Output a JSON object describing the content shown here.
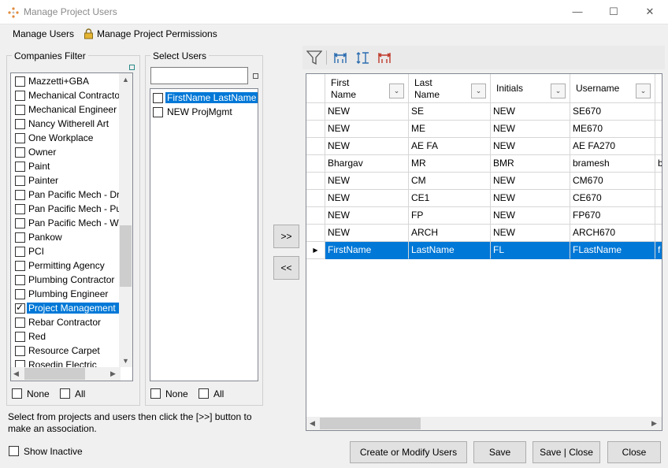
{
  "window": {
    "title": "Manage Project Users"
  },
  "menu": {
    "manage_users": "Manage Users",
    "manage_permissions": "Manage Project Permissions"
  },
  "companies": {
    "title": "Companies Filter",
    "items": [
      {
        "label": "Mazzetti+GBA",
        "checked": false,
        "selected": false
      },
      {
        "label": "Mechanical Contracto",
        "checked": false,
        "selected": false
      },
      {
        "label": "Mechanical Engineer",
        "checked": false,
        "selected": false
      },
      {
        "label": "Nancy Witherell Art",
        "checked": false,
        "selected": false
      },
      {
        "label": "One Workplace",
        "checked": false,
        "selected": false
      },
      {
        "label": "Owner",
        "checked": false,
        "selected": false
      },
      {
        "label": "Paint",
        "checked": false,
        "selected": false
      },
      {
        "label": "Painter",
        "checked": false,
        "selected": false
      },
      {
        "label": "Pan Pacific Mech - Dry",
        "checked": false,
        "selected": false
      },
      {
        "label": "Pan Pacific Mech - Pu",
        "checked": false,
        "selected": false
      },
      {
        "label": "Pan Pacific Mech - We",
        "checked": false,
        "selected": false
      },
      {
        "label": "Pankow",
        "checked": false,
        "selected": false
      },
      {
        "label": "PCI",
        "checked": false,
        "selected": false
      },
      {
        "label": "Permitting Agency",
        "checked": false,
        "selected": false
      },
      {
        "label": "Plumbing Contractor",
        "checked": false,
        "selected": false
      },
      {
        "label": "Plumbing Engineer",
        "checked": false,
        "selected": false
      },
      {
        "label": "Project Management",
        "checked": true,
        "selected": true
      },
      {
        "label": "Rebar Contractor",
        "checked": false,
        "selected": false
      },
      {
        "label": "Red",
        "checked": false,
        "selected": false
      },
      {
        "label": "Resource Carpet",
        "checked": false,
        "selected": false
      },
      {
        "label": "Rosedin Electric",
        "checked": false,
        "selected": false
      }
    ],
    "none_label": "None",
    "all_label": "All"
  },
  "users": {
    "title": "Select Users",
    "search_value": "",
    "items": [
      {
        "label": "FirstName LastName",
        "checked": false,
        "selected": true
      },
      {
        "label": "NEW ProjMgmt",
        "checked": false,
        "selected": false
      }
    ],
    "none_label": "None",
    "all_label": "All"
  },
  "transfer": {
    "add_label": ">>",
    "remove_label": "<<"
  },
  "hint_line1": "Select from projects and users then click the [>>] button to",
  "hint_line2": "make an association.",
  "show_inactive": {
    "label": "Show Inactive",
    "checked": false
  },
  "grid": {
    "columns": [
      {
        "line1": "First",
        "line2": "Name"
      },
      {
        "line1": "Last",
        "line2": "Name"
      },
      {
        "line1": "Initials",
        "line2": ""
      },
      {
        "line1": "Username",
        "line2": ""
      }
    ],
    "rows": [
      {
        "cells": [
          "NEW",
          "SE",
          "NEW",
          "SE670",
          ""
        ],
        "selected": false
      },
      {
        "cells": [
          "NEW",
          "ME",
          "NEW",
          "ME670",
          ""
        ],
        "selected": false
      },
      {
        "cells": [
          "NEW",
          "AE FA",
          "NEW",
          "AE FA270",
          ""
        ],
        "selected": false
      },
      {
        "cells": [
          "Bhargav",
          "MR",
          "BMR",
          "bramesh",
          "b"
        ],
        "selected": false
      },
      {
        "cells": [
          "NEW",
          "CM",
          "NEW",
          "CM670",
          ""
        ],
        "selected": false
      },
      {
        "cells": [
          "NEW",
          "CE1",
          "NEW",
          "CE670",
          ""
        ],
        "selected": false
      },
      {
        "cells": [
          "NEW",
          "FP",
          "NEW",
          "FP670",
          ""
        ],
        "selected": false
      },
      {
        "cells": [
          "NEW",
          "ARCH",
          "NEW",
          "ARCH670",
          ""
        ],
        "selected": false
      },
      {
        "cells": [
          "FirstName",
          "LastName",
          "FL",
          "FLastName",
          "f"
        ],
        "selected": true
      }
    ]
  },
  "buttons": {
    "create_modify": "Create or Modify Users",
    "save": "Save",
    "save_close": "Save | Close",
    "close": "Close"
  },
  "colors": {
    "selection": "#0078d7",
    "toolbar_icon": "#2b6cb0"
  }
}
